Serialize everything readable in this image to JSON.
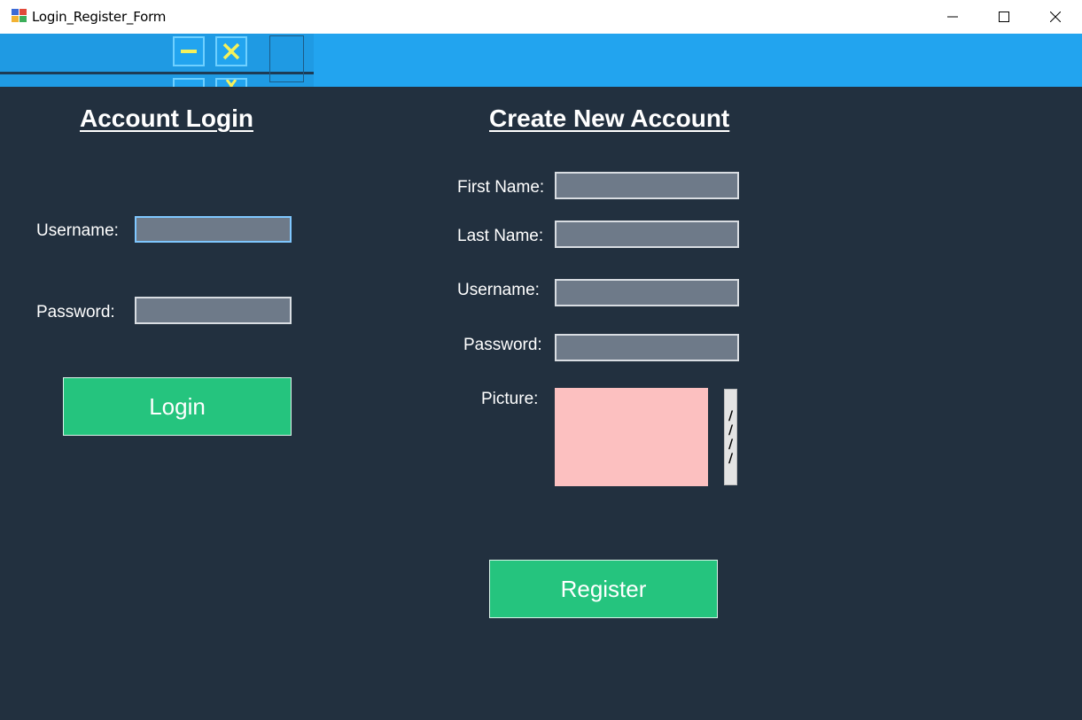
{
  "window": {
    "title": "Login_Register_Form",
    "controls": {
      "minimize": "—",
      "maximize": "☐",
      "close": "✕"
    }
  },
  "toolbar": {
    "minimize_icon": "minus-icon",
    "close_icon": "close-icon"
  },
  "login": {
    "heading": "Account Login",
    "username_label": "Username:",
    "username_value": "",
    "password_label": "Password:",
    "password_value": "",
    "button_label": "Login"
  },
  "register": {
    "heading": "Create New Account",
    "first_name_label": "First Name:",
    "last_name_label": "Last Name:",
    "username_label": "Username:",
    "password_label": "Password:",
    "picture_label": "Picture:",
    "first_name_value": "",
    "last_name_value": "",
    "username_value": "",
    "password_value": "",
    "browse_glyphs": [
      "/",
      "/",
      "/",
      "/"
    ],
    "button_label": "Register"
  },
  "colors": {
    "title_bar": "#ffffff",
    "toolbar_blue": "#22a4ef",
    "panel_dark": "#22303f",
    "input_gray": "#6e7a89",
    "button_green": "#25c47e",
    "picture_pink": "#fcc0c0",
    "icon_yellow": "#f5f15b"
  }
}
